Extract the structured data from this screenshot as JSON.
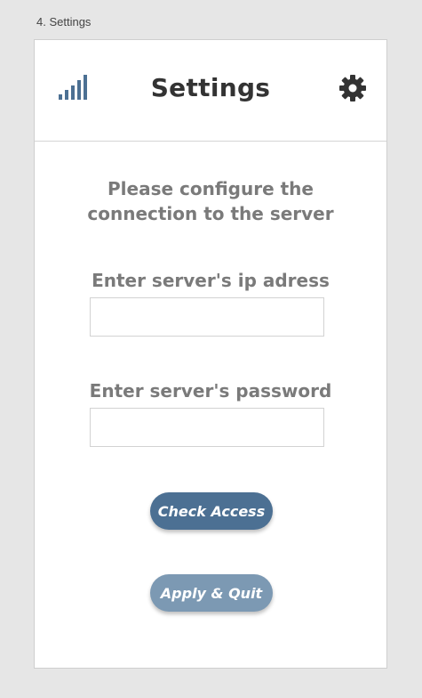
{
  "artboard": {
    "label": "4. Settings"
  },
  "header": {
    "title": "Settings",
    "signal_icon": "signal-strength-icon",
    "settings_icon": "gear-icon"
  },
  "intro": {
    "text": "Please configure the connection to the server"
  },
  "form": {
    "ip": {
      "label": "Enter server's ip adress",
      "value": "",
      "placeholder": ""
    },
    "password": {
      "label": "Enter server's password",
      "value": "",
      "placeholder": ""
    }
  },
  "buttons": {
    "check_label": "Check Access",
    "apply_label": "Apply & Quit"
  },
  "colors": {
    "accent": "#4c7093",
    "accent_light": "#7c99b3",
    "text_gray": "#7a7a7a",
    "title": "#333333"
  }
}
